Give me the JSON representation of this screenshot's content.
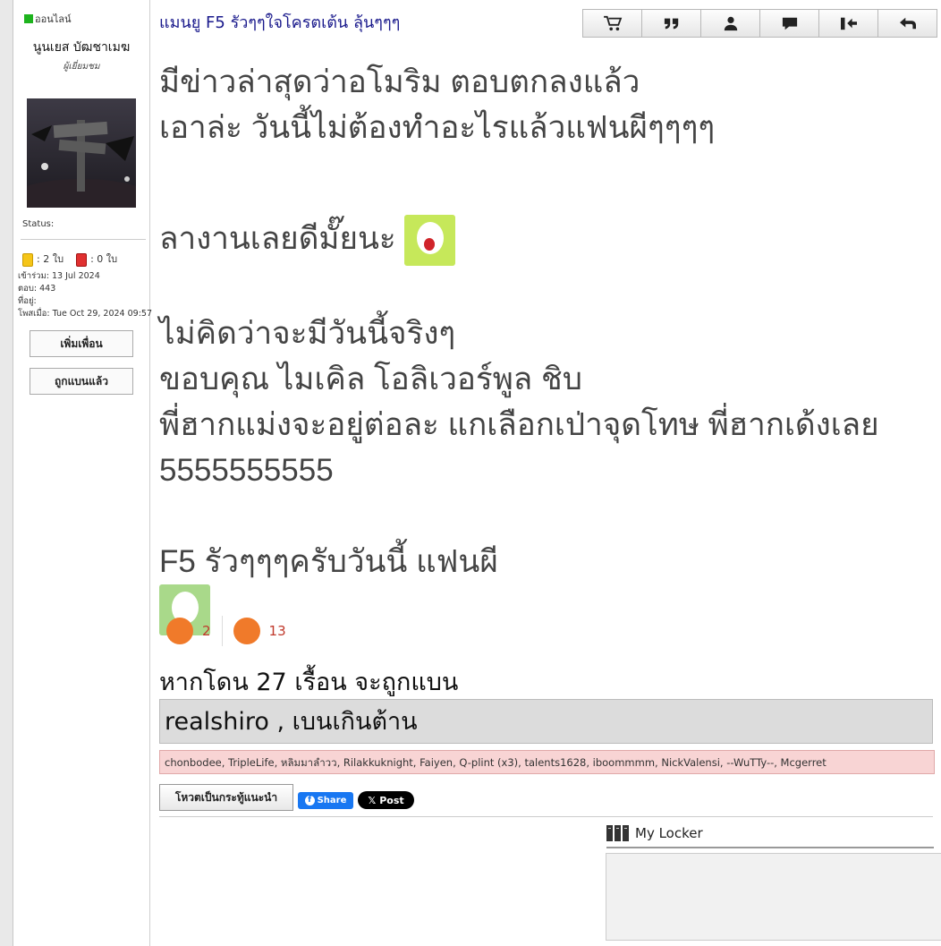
{
  "profile": {
    "online_label": "ออนไลน์",
    "username": "นูนเยส บัฒชาเมฆ",
    "rank": "ผู้เยี่ยมชม",
    "status_label": "Status:",
    "yellow_cards": ": 2 ใบ",
    "red_cards": ": 0 ใบ",
    "joined": "เข้าร่วม: 13 Jul 2024",
    "replies": "ตอบ: 443",
    "location": "ที่อยู่:",
    "posted": "โพสเมื่อ: Tue Oct 29, 2024 09:57",
    "add_friend": "เพิ่มเพื่อน",
    "banned": "ถูกแบนแล้ว"
  },
  "topic": {
    "title": "แมนยู F5 รัวๆๆใจโครตเต้น ลุ้นๆๆๆ"
  },
  "toolbar": [
    "cart-icon",
    "quote-icon",
    "user-icon",
    "message-icon",
    "move-icon",
    "reply-icon"
  ],
  "post": {
    "line1": "มีข่าวล่าสุดว่าอโมริม ตอบตกลงแล้ว",
    "line2": "เอาล่ะ วันนี้ไม่ต้องทำอะไรแล้วแฟนผีๆๆๆๆ",
    "line3": "ลางานเลยดีมั๊ยนะ",
    "line4": "ไม่คิดว่าจะมีวันนี้จริงๆ",
    "line5": "ขอบคุณ ไมเคิล โอลิเวอร์พูล ชิบ",
    "line6": "พี่ฮากแม่งจะอยู่ต่อละ แกเลือกเป่าจุดโทษ พี่ฮากเด้งเลย",
    "line7": "5555555555",
    "line8": "F5 รัวๆๆๆครับวันนี้ แฟนผี"
  },
  "reactions": {
    "first_count": "2",
    "second_count": "13"
  },
  "ban": {
    "text": "หากโดน 27 เรื้อน จะถูกแบน",
    "box_text": "realshiro , เบนเกินต้าน",
    "voters": "chonbodee, TripleLife, หลิมมาลำวว, Rilakkuknight, Faiyen, Q-plint (x3), talents1628, iboommmm, NickValensi, --WuTTy--, Mcgerret"
  },
  "actions": {
    "vote_button": "โหวตเป็นกระทู้แนะนำ",
    "share": "Share",
    "post": "Post"
  },
  "locker": {
    "title": "My Locker"
  }
}
